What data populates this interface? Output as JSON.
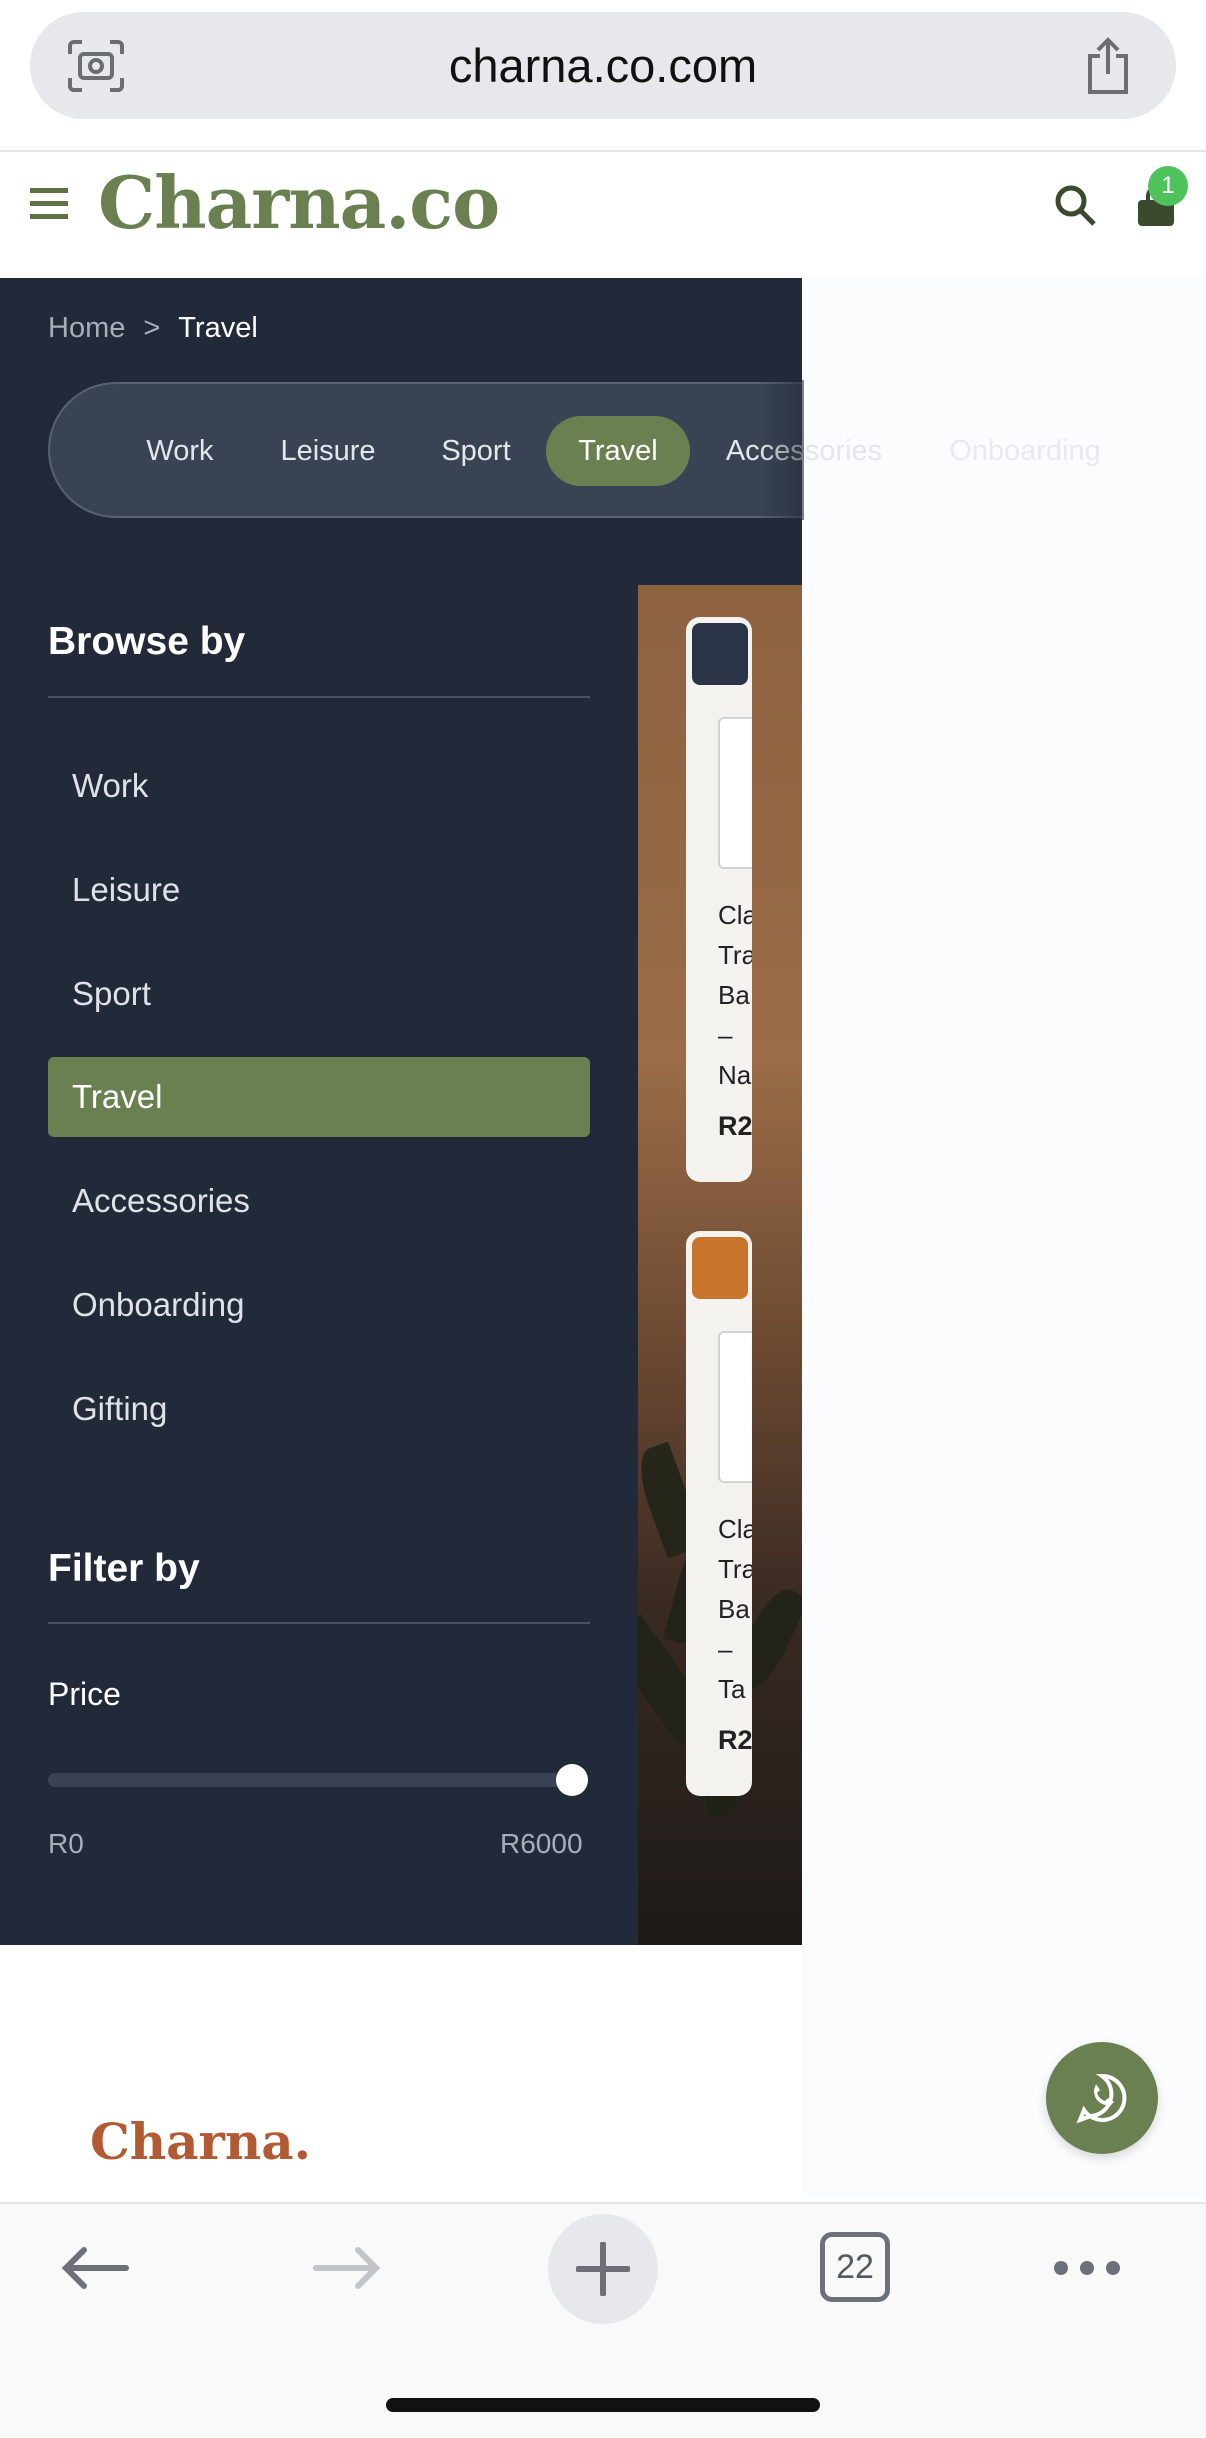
{
  "browser": {
    "url": "charna.co.com",
    "tab_count": "22",
    "icons": [
      "camera-scan-icon",
      "share-icon",
      "back-arrow-icon",
      "forward-arrow-icon",
      "plus-icon",
      "tabs-icon",
      "more-icon"
    ]
  },
  "header": {
    "logo": "Charna.co",
    "cart_count": "1",
    "icons": [
      "hamburger-menu-icon",
      "search-icon",
      "shopping-bag-icon"
    ],
    "brand_color": "#6a8051"
  },
  "breadcrumb": {
    "home": "Home",
    "separator": ">",
    "current": "Travel"
  },
  "category_tabs": [
    {
      "label": "Work",
      "active": false
    },
    {
      "label": "Leisure",
      "active": false
    },
    {
      "label": "Sport",
      "active": false
    },
    {
      "label": "Travel",
      "active": true
    },
    {
      "label": "Accessories",
      "active": false
    },
    {
      "label": "Onboarding",
      "active": false
    }
  ],
  "browse": {
    "title": "Browse by",
    "items": [
      {
        "label": "Work",
        "active": false
      },
      {
        "label": "Leisure",
        "active": false
      },
      {
        "label": "Sport",
        "active": false
      },
      {
        "label": "Travel",
        "active": true
      },
      {
        "label": "Accessories",
        "active": false
      },
      {
        "label": "Onboarding",
        "active": false
      },
      {
        "label": "Gifting",
        "active": false
      }
    ]
  },
  "filter": {
    "title": "Filter by",
    "price_label": "Price",
    "min": "R0",
    "max": "R6000",
    "slider_value_fraction": 1.0
  },
  "products": [
    {
      "name_lines": [
        "Cla",
        "Tra",
        "Ba",
        "–",
        "Na"
      ],
      "price": "R2",
      "thumb_color": "#2b3447"
    },
    {
      "name_lines": [
        "Cla",
        "Tra",
        "Ba",
        "–",
        "Ta"
      ],
      "price": "R2",
      "thumb_color": "#c8742c"
    }
  ],
  "footer": {
    "logo": "Charna.",
    "logo_color": "#b15a33",
    "whatsapp_icon": "whatsapp-icon"
  }
}
